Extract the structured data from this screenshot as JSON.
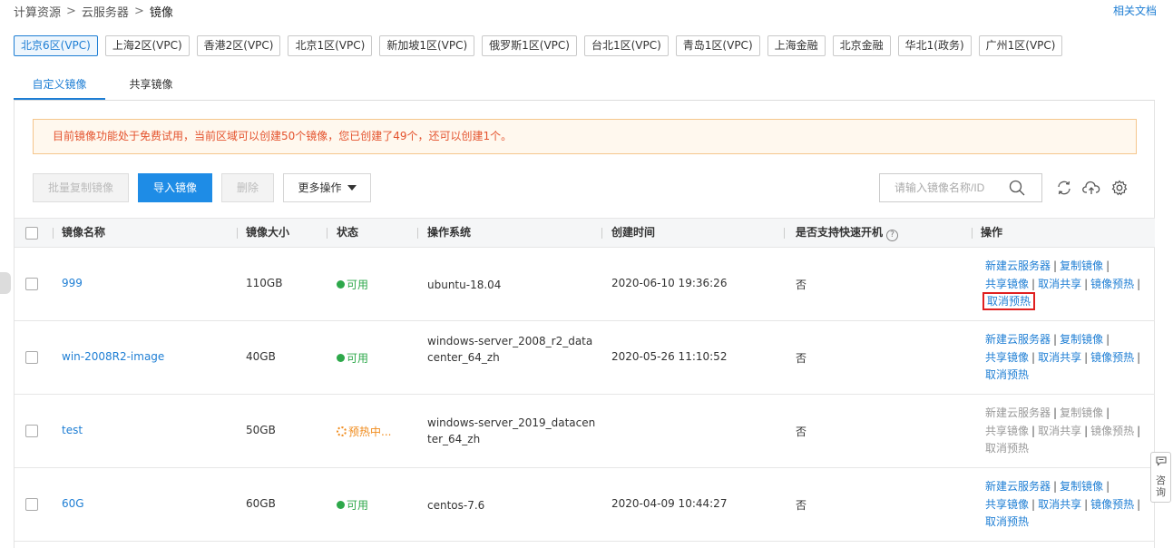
{
  "breadcrumb": {
    "item1": "计算资源",
    "sep": ">",
    "item2": "云服务器",
    "item3": "镜像"
  },
  "doc_link": "相关文档",
  "regions": [
    "北京6区(VPC)",
    "上海2区(VPC)",
    "香港2区(VPC)",
    "北京1区(VPC)",
    "新加坡1区(VPC)",
    "俄罗斯1区(VPC)",
    "台北1区(VPC)",
    "青岛1区(VPC)",
    "上海金融",
    "北京金融",
    "华北1(政务)",
    "广州1区(VPC)"
  ],
  "tabs": [
    "自定义镜像",
    "共享镜像"
  ],
  "notice": "目前镜像功能处于免费试用，当前区域可以创建50个镜像，您已创建了49个，还可以创建1个。",
  "toolbar": {
    "batch_copy": "批量复制镜像",
    "import": "导入镜像",
    "delete": "删除",
    "more": "更多操作"
  },
  "search": {
    "placeholder": "请输入镜像名称/ID"
  },
  "columns": [
    "镜像名称",
    "镜像大小",
    "状态",
    "操作系统",
    "创建时间",
    "是否支持快速开机",
    "操作"
  ],
  "rows": [
    {
      "name": "999",
      "size": "110GB",
      "status": "可用",
      "os": "ubuntu-18.04",
      "created": "2020-06-10 19:36:26",
      "fast_boot": "否"
    },
    {
      "name": "win-2008R2-image",
      "size": "40GB",
      "status": "可用",
      "os": "windows-server_2008_r2_datacenter_64_zh",
      "created": "2020-05-26 11:10:52",
      "fast_boot": "否"
    },
    {
      "name": "test",
      "size": "50GB",
      "status": "预热中...",
      "os": "windows-server_2019_datacenter_64_zh",
      "created": "",
      "fast_boot": "否"
    },
    {
      "name": "60G",
      "size": "60GB",
      "status": "可用",
      "os": "centos-7.6",
      "created": "2020-04-09 10:44:27",
      "fast_boot": "否"
    }
  ],
  "ops": {
    "create": "新建云服务器",
    "copy": "复制镜像",
    "share": "共享镜像",
    "unshare": "取消共享",
    "preheat": "镜像预热",
    "cancel_preheat": "取消预热",
    "bar": "|"
  },
  "consult": "咨询",
  "colors": {
    "primary": "#1e8ce6",
    "link": "#1e7ed4",
    "available": "#2da84a",
    "warming": "#f08c1e",
    "highlight": "#e02020"
  }
}
